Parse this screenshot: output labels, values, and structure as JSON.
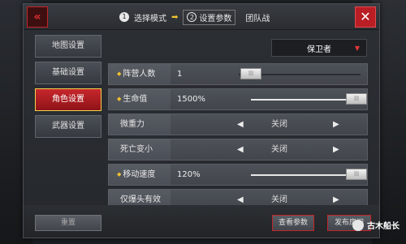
{
  "header": {
    "back_icon": "double-chevron-left-icon",
    "steps": [
      {
        "num": "1",
        "label": "选择模式"
      },
      {
        "num": "2",
        "label": "设置参数"
      }
    ],
    "mode_title": "团队战",
    "close_icon": "close-x-icon"
  },
  "nav": {
    "items": [
      {
        "label": "地图设置",
        "active": false
      },
      {
        "label": "基础设置",
        "active": false
      },
      {
        "label": "角色设置",
        "active": true
      },
      {
        "label": "武器设置",
        "active": false
      }
    ]
  },
  "team_select": {
    "value": "保卫者"
  },
  "settings": [
    {
      "label": "阵营人数",
      "value": "1",
      "type": "slider",
      "level": 0.0
    },
    {
      "label": "生命值",
      "value": "1500%",
      "type": "slider",
      "level": 1.0
    },
    {
      "label": "微重力",
      "value": "关闭",
      "type": "toggle"
    },
    {
      "label": "死亡变小",
      "value": "关闭",
      "type": "toggle"
    },
    {
      "label": "移动速度",
      "value": "120%",
      "type": "slider",
      "level": 1.0
    },
    {
      "label": "仅爆头有效",
      "value": "关闭",
      "type": "toggle"
    }
  ],
  "footer": {
    "reset_label": "重置",
    "view_label": "查看参数",
    "publish_label": "发布房间"
  },
  "watermark": {
    "text": "古木船长"
  },
  "colors": {
    "accent_red": "#c7272c",
    "active_border": "#f1d44a",
    "dot_yellow": "#f0c030"
  }
}
